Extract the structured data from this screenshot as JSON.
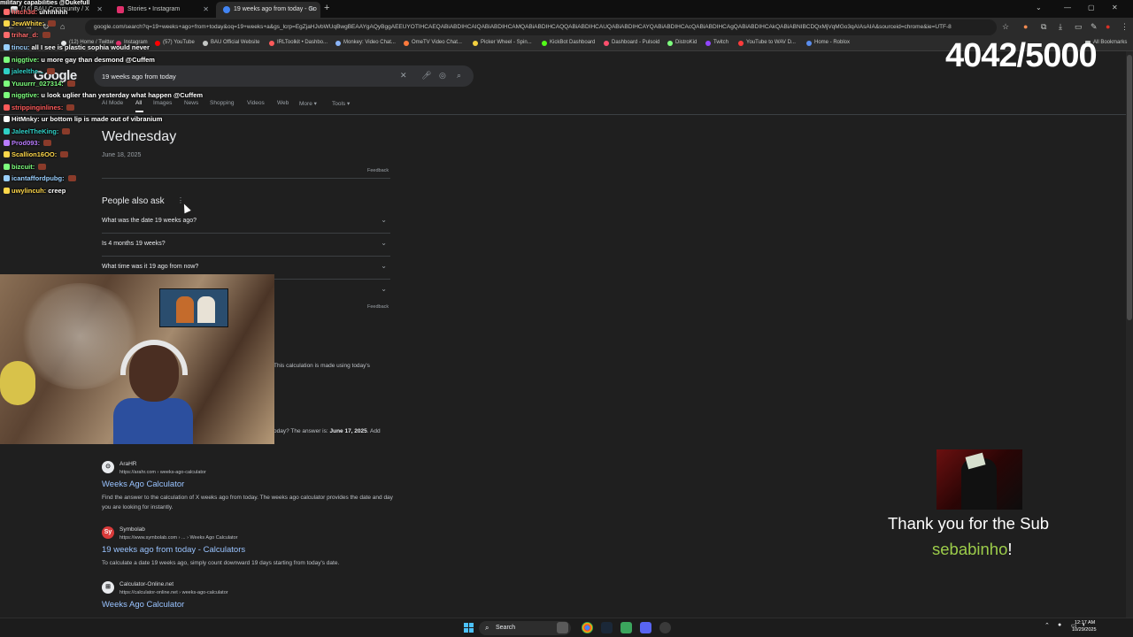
{
  "browser": {
    "tabs": [
      {
        "label": "(14) BAU Community / X",
        "active": false
      },
      {
        "label": "Stories • Instagram",
        "active": false
      },
      {
        "label": "19 weeks ago from today - Go",
        "active": true
      }
    ],
    "new_tab": "+",
    "url": "google.com/search?q=19+weeks+ago+from+today&oq=19+weeks+a&gs_lcrp=EgZjaHJvbWUqBwgBEAAYgAQyBggAEEUYOTIHCAEQABiABDIHCAIQABiABDIHCAMQABiABDIHCAQQABiABDIHCAUQABiABDIHCAYQABiABDIHCAcQABiABDIHCAgQABiABDIHCAkQABiABNIBCDQxMjVqMGo3qAIAsAIA&sourceid=chrome&ie=UTF-8",
    "bookmarks": [
      "(12) Home / Twitter",
      "Instagram",
      "(57) YouTube",
      "BAU Official Website",
      "IRLToolkit • Dashbo...",
      "Monkey: Video Chat...",
      "OmeTV Video Chat...",
      "Picker Wheel - Spin...",
      "KickBot Dashboard",
      "Dashboard - Pulsoid",
      "DistroKid",
      "Twitch",
      "YouTube to WAV D...",
      "Home - Roblox"
    ],
    "all_bookmarks": "All Bookmarks"
  },
  "google": {
    "logo": "Google",
    "query": "19 weeks ago from today",
    "tabs": [
      "AI Mode",
      "All",
      "Images",
      "News",
      "Shopping",
      "Videos",
      "Web",
      "More ▾",
      "Tools ▾"
    ],
    "answer_day": "Wednesday",
    "answer_date": "June 18, 2025",
    "feedback": "Feedback",
    "paa_title": "People also ask",
    "paa_questions": [
      "What was the date 19 weeks ago?",
      "Is 4 months 19 weeks?",
      "What time was it 19 ago from now?"
    ],
    "snippet_fragment_1": "This calculation is made using today's",
    "snippet_fragment_2_pre": "oday? The answer is: ",
    "snippet_fragment_2_bold": "June 17, 2025",
    "snippet_fragment_2_post": ". Add",
    "results": [
      {
        "site": "AraHR",
        "cite": "https://arahr.com › weeks-ago-calculator",
        "icon": "⊙",
        "title": "Weeks Ago Calculator",
        "desc": "Find the answer to the calculation of X weeks ago from today. The weeks ago calculator provides the date and day you are looking for instantly."
      },
      {
        "site": "Symbolab",
        "cite": "https://www.symbolab.com › ... › Weeks Ago Calculator",
        "icon": "Sy",
        "title": "19 weeks ago from today - Calculators",
        "desc": "To calculate a date 19 weeks ago, simply count downward 19 days starting from today's date."
      },
      {
        "site": "Calculator-Online.net",
        "cite": "https://calculator-online.net › weeks-ago-calculator",
        "icon": "⊞",
        "title": "Weeks Ago Calculator",
        "desc": ""
      }
    ]
  },
  "overlay": {
    "chat_top": "military capabilities @Dukefull",
    "chat": [
      {
        "user": "hitch3d:",
        "msg": "uhhhhhh",
        "color": "#ff6b6b"
      },
      {
        "user": "JewWhite:",
        "msg": "",
        "color": "#ffd84a"
      },
      {
        "user": "trihar_d:",
        "msg": "",
        "color": "#ff6b6b"
      },
      {
        "user": "tincu:",
        "msg": "all I see is plastic sophia would never",
        "color": "#9ad0ff"
      },
      {
        "user": "",
        "msg": "",
        "color": "#ffffff"
      },
      {
        "user": "niggtive:",
        "msg": "u more gay than desmond @Cuffem",
        "color": "#7dff7d"
      },
      {
        "user": "jaleelthe...",
        "msg": "",
        "color": "#2fd0c6"
      },
      {
        "user": "Yuuurrr_027314:",
        "msg": "",
        "color": "#7dff7d"
      },
      {
        "user": "niggtive:",
        "msg": "u look uglier than yesterday what happen @Cuffem",
        "color": "#7dff7d"
      },
      {
        "user": "strippinginlines:",
        "msg": "",
        "color": "#ff5a5a"
      },
      {
        "user": "HitMnky:",
        "msg": "ur bottom lip is made out of vibranium",
        "color": "#ffffff"
      },
      {
        "user": "JaleelTheKing:",
        "msg": "",
        "color": "#2fd0c6"
      },
      {
        "user": "Prod093:",
        "msg": "",
        "color": "#b97cff"
      },
      {
        "user": "Scallion16OO:",
        "msg": "",
        "color": "#ffd84a"
      },
      {
        "user": "bizcuit:",
        "msg": "",
        "color": "#7dff7d"
      },
      {
        "user": "icantaffordpubg:",
        "msg": "",
        "color": "#9ad0ff"
      },
      {
        "user": "uwylincuh:",
        "msg": "creep",
        "color": "#ffd84a"
      }
    ],
    "counter": "4042/5000",
    "sub_title": "Thank you for the Sub",
    "sub_name": "sebabinho",
    "sub_bang": "!"
  },
  "taskbar": {
    "search_label": "Search",
    "time": "12:17 AM",
    "date": "10/29/2025"
  },
  "colors": {
    "link": "#99c3ff",
    "page_bg": "#1f1f1f",
    "sub_name": "#9ccc4a",
    "windows_accent": "#4cc2ff"
  }
}
